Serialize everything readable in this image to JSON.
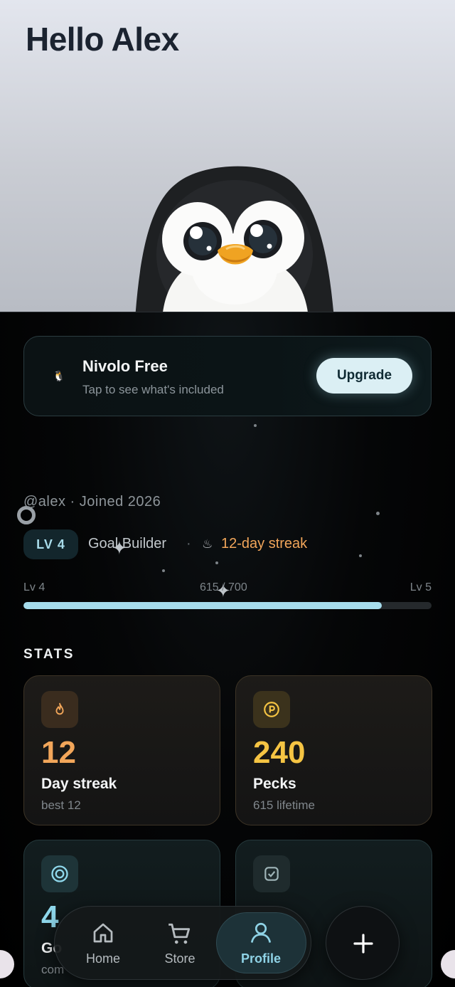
{
  "greeting": "Hello Alex",
  "plan": {
    "title": "Nivolo Free",
    "subtitle": "Tap to see what's included",
    "upgrade_label": "Upgrade",
    "icon": "penguin-icon"
  },
  "profile": {
    "meta": "@alex · Joined 2026",
    "level_badge": "LV 4",
    "role": "Goal Builder",
    "separator": "·",
    "streak_icon": "flame-icon",
    "streak_text": "12-day streak",
    "streak_color": "#f2a65a"
  },
  "progress": {
    "from_label": "Lv 4",
    "to_label": "Lv 5",
    "value_label": "615 / 700",
    "current": 615,
    "max": 700,
    "fill_color": "#a6dcec"
  },
  "stats": {
    "title": "STATS",
    "cards": [
      {
        "icon": "flame-icon",
        "value": "12",
        "label": "Day streak",
        "sub": "best 12",
        "color": "#f2a65a"
      },
      {
        "icon": "coin-icon",
        "value": "240",
        "label": "Pecks",
        "sub": "615 lifetime",
        "color": "#f5c443"
      },
      {
        "icon": "target-icon",
        "value": "4",
        "label": "Go",
        "sub": "com",
        "color": "#8fd8ec"
      },
      {
        "icon": "checkbox-icon",
        "value": "",
        "label": "",
        "sub": "",
        "color": "#9fb5b8"
      }
    ]
  },
  "nav": {
    "items": [
      {
        "label": "Home",
        "icon": "home-icon"
      },
      {
        "label": "Store",
        "icon": "cart-icon"
      },
      {
        "label": "Profile",
        "icon": "user-icon",
        "active": true
      }
    ],
    "fab_icon": "plus-icon",
    "active_color": "#8fd3e6"
  }
}
